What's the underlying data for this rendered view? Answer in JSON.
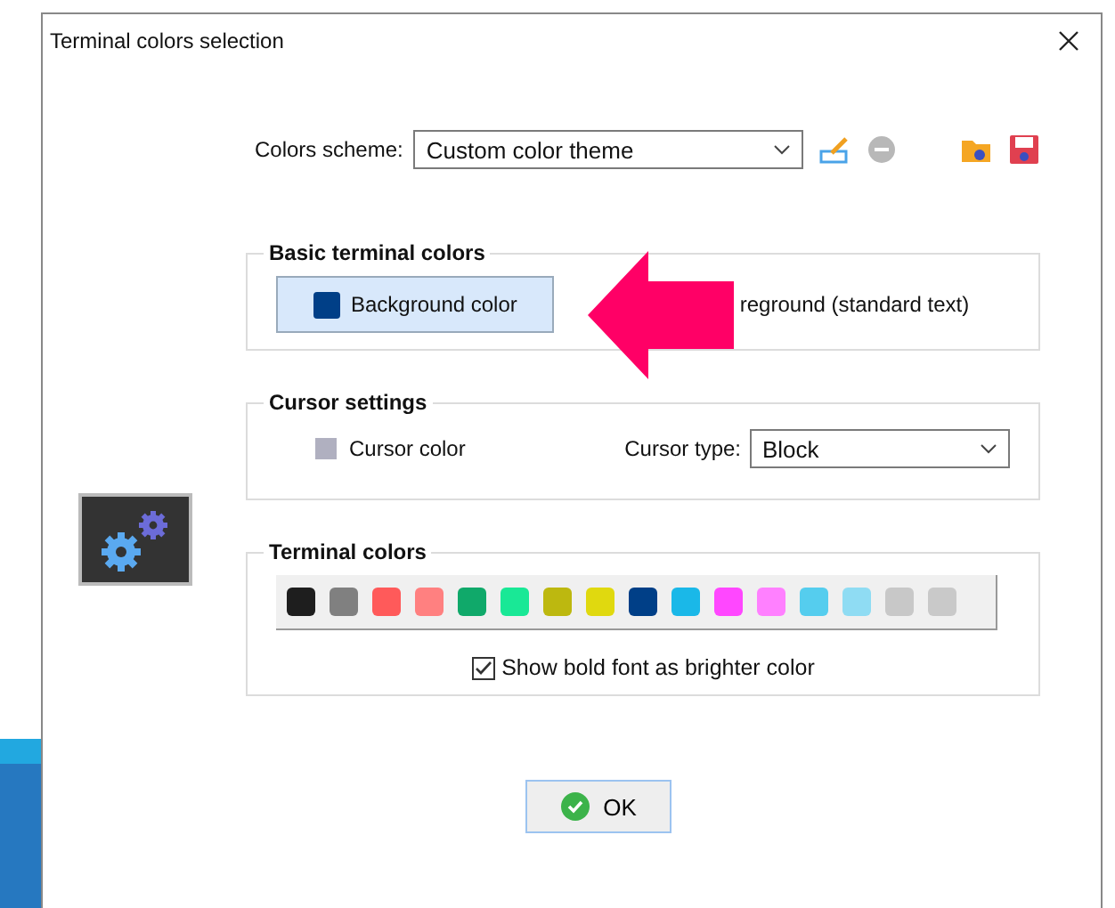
{
  "window": {
    "title": "Terminal colors selection"
  },
  "scheme": {
    "label": "Colors scheme:",
    "value": "Custom color theme"
  },
  "basic": {
    "title": "Basic terminal colors",
    "background": {
      "label": "Background color",
      "color": "#003f87",
      "selected": true
    },
    "foreground": {
      "label": "reground (standard text)"
    }
  },
  "cursor": {
    "title": "Cursor settings",
    "color_label": "Cursor color",
    "color": "#b0b0c0",
    "type_label": "Cursor type:",
    "type_value": "Block"
  },
  "terminal": {
    "title": "Terminal colors",
    "palette": [
      {
        "color": "#1e1e1e"
      },
      {
        "color": "#808080"
      },
      {
        "color": "#ff5a5a"
      },
      {
        "color": "#ff8080"
      },
      {
        "color": "#10a96a"
      },
      {
        "color": "#19e896"
      },
      {
        "color": "#bdb80f"
      },
      {
        "color": "#e0d90f"
      },
      {
        "color": "#003f87"
      },
      {
        "color": "#1ab8e8"
      },
      {
        "color": "#ff47ff"
      },
      {
        "color": "#ff80ff"
      },
      {
        "color": "#55cdee"
      },
      {
        "color": "#8fdcf3"
      },
      {
        "color": "#c8c8c8"
      },
      {
        "color": "#c9c9c9"
      }
    ],
    "bold_bright": {
      "label": "Show bold font as brighter color",
      "checked": true
    }
  },
  "buttons": [
    {
      "label": "OK"
    }
  ]
}
